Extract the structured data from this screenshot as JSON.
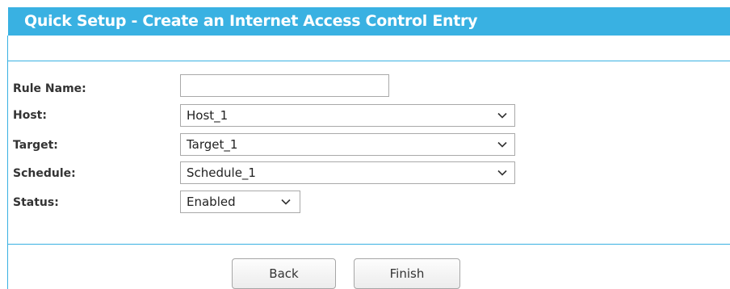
{
  "header": {
    "title": "Quick Setup - Create an Internet Access Control Entry"
  },
  "form": {
    "rule_name": {
      "label": "Rule Name:",
      "value": ""
    },
    "host": {
      "label": "Host:",
      "selected": "Host_1"
    },
    "target": {
      "label": "Target:",
      "selected": "Target_1"
    },
    "schedule": {
      "label": "Schedule:",
      "selected": "Schedule_1"
    },
    "status": {
      "label": "Status:",
      "selected": "Enabled"
    }
  },
  "buttons": {
    "back": "Back",
    "finish": "Finish"
  },
  "colors": {
    "accent": "#39b1e2",
    "header_text": "#ffffff"
  },
  "icons": {
    "dropdown": "chevron-down-icon"
  }
}
